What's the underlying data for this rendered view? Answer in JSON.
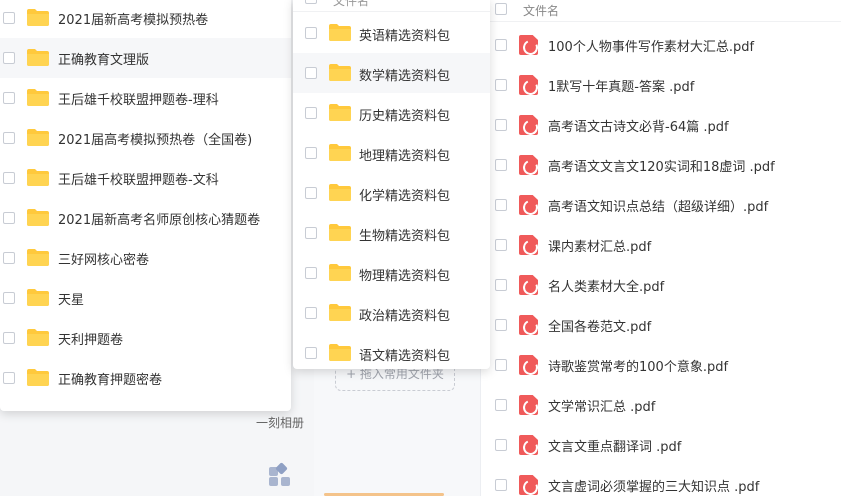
{
  "colors": {
    "folder": "#ffc93c",
    "pdf": "#f05a5a",
    "menu_bg": "#ffffff",
    "highlight": "#f6f7f9"
  },
  "left_menu": {
    "items": [
      {
        "label": "2021届新高考模拟预热卷",
        "icon": "folder-icon"
      },
      {
        "label": "正确教育文理版",
        "icon": "folder-icon",
        "hovered": true
      },
      {
        "label": "王后雄千校联盟押题卷-理科",
        "icon": "folder-icon"
      },
      {
        "label": "2021届高考模拟预热卷（全国卷)",
        "icon": "folder-icon"
      },
      {
        "label": "王后雄千校联盟押题卷-文科",
        "icon": "folder-icon"
      },
      {
        "label": "2021届新高考名师原创核心猜题卷",
        "icon": "folder-icon"
      },
      {
        "label": "三好网核心密卷",
        "icon": "folder-icon"
      },
      {
        "label": "天星",
        "icon": "folder-icon"
      },
      {
        "label": "天利押题卷",
        "icon": "folder-icon"
      },
      {
        "label": "正确教育押题密卷",
        "icon": "folder-icon"
      }
    ]
  },
  "mid_menu": {
    "header": "文件名",
    "items": [
      {
        "label": "英语精选资料包",
        "icon": "folder-icon"
      },
      {
        "label": "数学精选资料包",
        "icon": "folder-icon",
        "hovered": true
      },
      {
        "label": "历史精选资料包",
        "icon": "folder-icon"
      },
      {
        "label": "地理精选资料包",
        "icon": "folder-icon"
      },
      {
        "label": "化学精选资料包",
        "icon": "folder-icon"
      },
      {
        "label": "生物精选资料包",
        "icon": "folder-icon"
      },
      {
        "label": "物理精选资料包",
        "icon": "folder-icon"
      },
      {
        "label": "政治精选资料包",
        "icon": "folder-icon"
      },
      {
        "label": "语文精选资料包",
        "icon": "folder-icon"
      }
    ]
  },
  "background": {
    "add_common_folder": "+ 拖入常用文件夹",
    "album_label": "一刻相册",
    "apps_icon": "apps-grid-icon"
  },
  "file_list": {
    "header": "文件名",
    "files": [
      {
        "name": "100个人物事件写作素材大汇总.pdf",
        "icon": "pdf-icon"
      },
      {
        "name": "1默写十年真题-答案 .pdf",
        "icon": "pdf-icon"
      },
      {
        "name": "高考语文古诗文必背-64篇 .pdf",
        "icon": "pdf-icon"
      },
      {
        "name": "高考语文文言文120实词和18虚词 .pdf",
        "icon": "pdf-icon"
      },
      {
        "name": "高考语文知识点总结（超级详细）.pdf",
        "icon": "pdf-icon"
      },
      {
        "name": "课内素材汇总.pdf",
        "icon": "pdf-icon"
      },
      {
        "name": "名人类素材大全.pdf",
        "icon": "pdf-icon"
      },
      {
        "name": "全国各卷范文.pdf",
        "icon": "pdf-icon"
      },
      {
        "name": "诗歌鉴赏常考的100个意象.pdf",
        "icon": "pdf-icon"
      },
      {
        "name": "文学常识汇总 .pdf",
        "icon": "pdf-icon"
      },
      {
        "name": "文言文重点翻译词 .pdf",
        "icon": "pdf-icon"
      },
      {
        "name": "文言虚词必须掌握的三大知识点 .pdf",
        "icon": "pdf-icon"
      }
    ]
  }
}
